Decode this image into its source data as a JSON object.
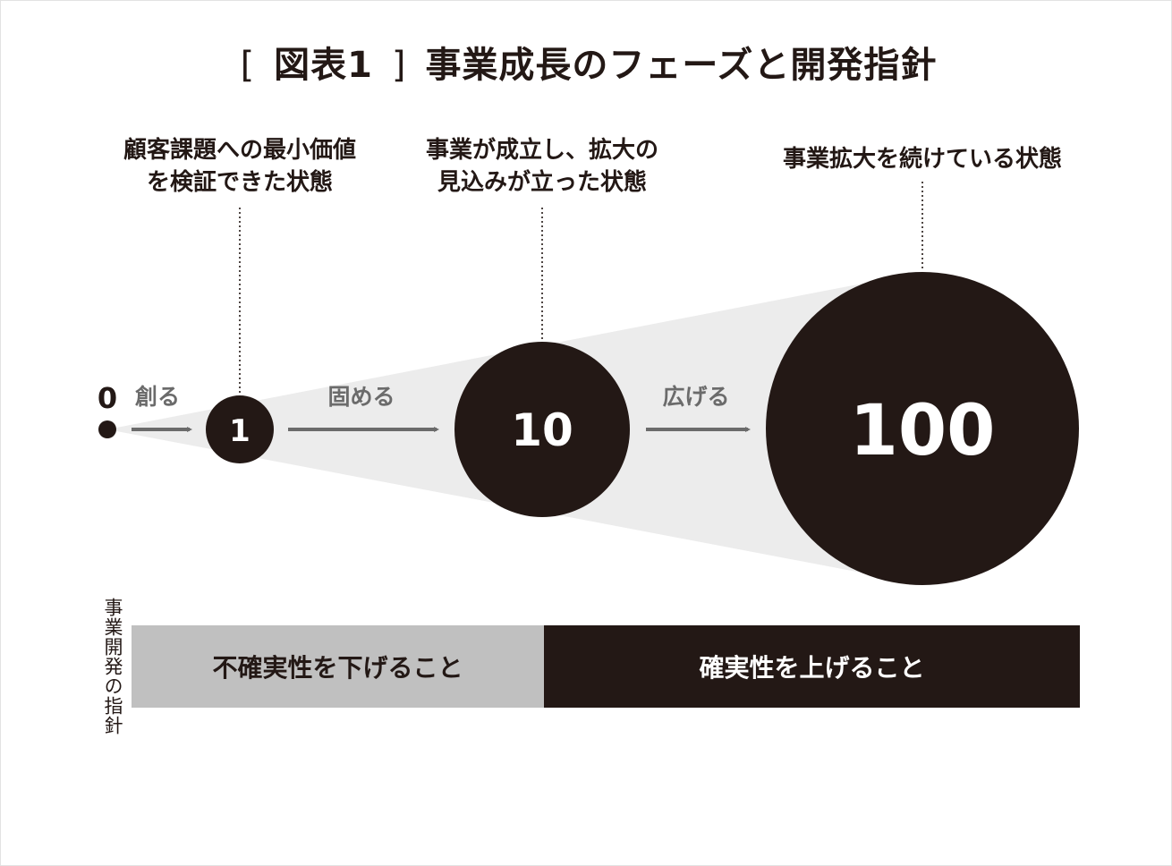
{
  "title": {
    "bracket_open": "[",
    "fig_label": "図表1",
    "bracket_close": "]",
    "text": "事業成長のフェーズと開発指針"
  },
  "stages": [
    {
      "value": "0"
    },
    {
      "value": "1",
      "description_lines": [
        "顧客課題への最小価値",
        "を検証できた状態"
      ]
    },
    {
      "value": "10",
      "description_lines": [
        "事業が成立し、拡大の",
        "見込みが立った状態"
      ]
    },
    {
      "value": "100",
      "description_lines": [
        "事業拡大を続けている状態"
      ]
    }
  ],
  "arrows": [
    {
      "label": "創る"
    },
    {
      "label": "固める"
    },
    {
      "label": "広げる"
    }
  ],
  "guideline": {
    "vertical_label": "事業開発の指針",
    "left_bar": "不確実性を下げること",
    "right_bar": "確実性を上げること"
  },
  "colors": {
    "dark": "#231815",
    "cone": "#ececec",
    "arrow": "#6b6b6b",
    "bar_light": "#c0c0c0",
    "white": "#ffffff"
  }
}
